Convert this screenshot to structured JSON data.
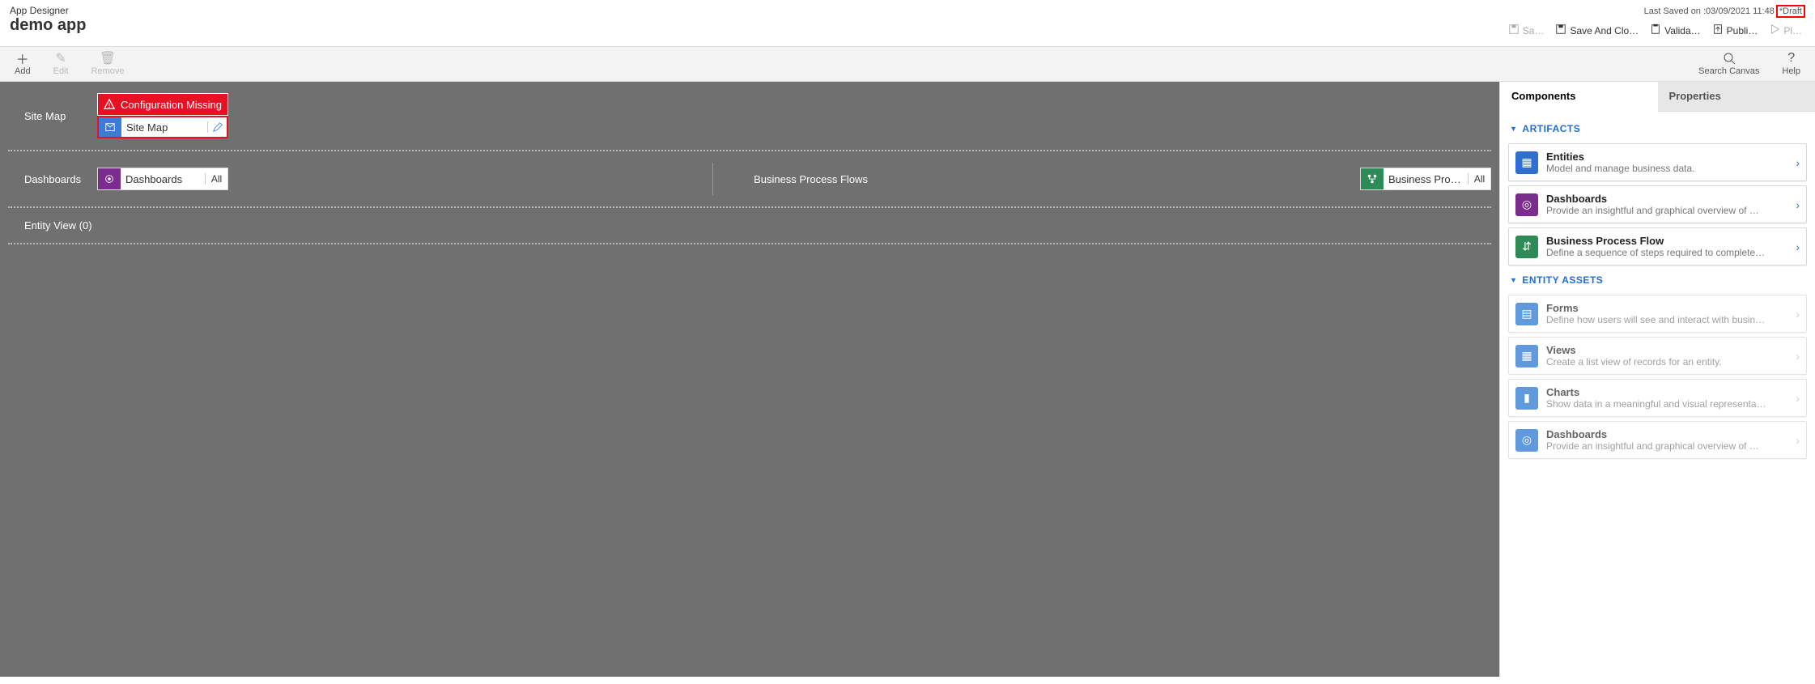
{
  "header": {
    "app_label": "App Designer",
    "app_name": "demo app",
    "last_saved_prefix": "Last Saved on :",
    "last_saved_value": "03/09/2021 11:48",
    "draft_label": "*Draft",
    "actions": {
      "save": "Sa…",
      "save_close": "Save And Clo…",
      "validate": "Valida…",
      "publish": "Publi…",
      "play": "Pl…"
    }
  },
  "toolbar": {
    "add": "Add",
    "edit": "Edit",
    "remove": "Remove",
    "search": "Search Canvas",
    "help": "Help"
  },
  "canvas": {
    "sitemap_label": "Site Map",
    "config_missing": "Configuration Missing",
    "sitemap_tile": "Site Map",
    "dashboards_label": "Dashboards",
    "dashboards_tile": "Dashboards",
    "dashboards_badge": "All",
    "bpf_label": "Business Process Flows",
    "bpf_tile": "Business Proces…",
    "bpf_badge": "All",
    "entity_view": "Entity View (0)"
  },
  "side": {
    "tabs": {
      "components": "Components",
      "properties": "Properties"
    },
    "groups": {
      "artifacts": "ARTIFACTS",
      "entity_assets": "ENTITY ASSETS"
    },
    "artifacts": [
      {
        "title": "Entities",
        "desc": "Model and manage business data.",
        "icon": "grid",
        "color": "ci-blue"
      },
      {
        "title": "Dashboards",
        "desc": "Provide an insightful and graphical overview of …",
        "icon": "target",
        "color": "ci-purple"
      },
      {
        "title": "Business Process Flow",
        "desc": "Define a sequence of steps required to complete…",
        "icon": "flow",
        "color": "ci-green"
      }
    ],
    "entity_assets": [
      {
        "title": "Forms",
        "desc": "Define how users will see and interact with busin…",
        "icon": "form",
        "color": "ci-blue2"
      },
      {
        "title": "Views",
        "desc": "Create a list view of records for an entity.",
        "icon": "table",
        "color": "ci-blue2"
      },
      {
        "title": "Charts",
        "desc": "Show data in a meaningful and visual representa…",
        "icon": "chart",
        "color": "ci-blue2"
      },
      {
        "title": "Dashboards",
        "desc": "Provide an insightful and graphical overview of …",
        "icon": "target",
        "color": "ci-blue2"
      }
    ]
  }
}
